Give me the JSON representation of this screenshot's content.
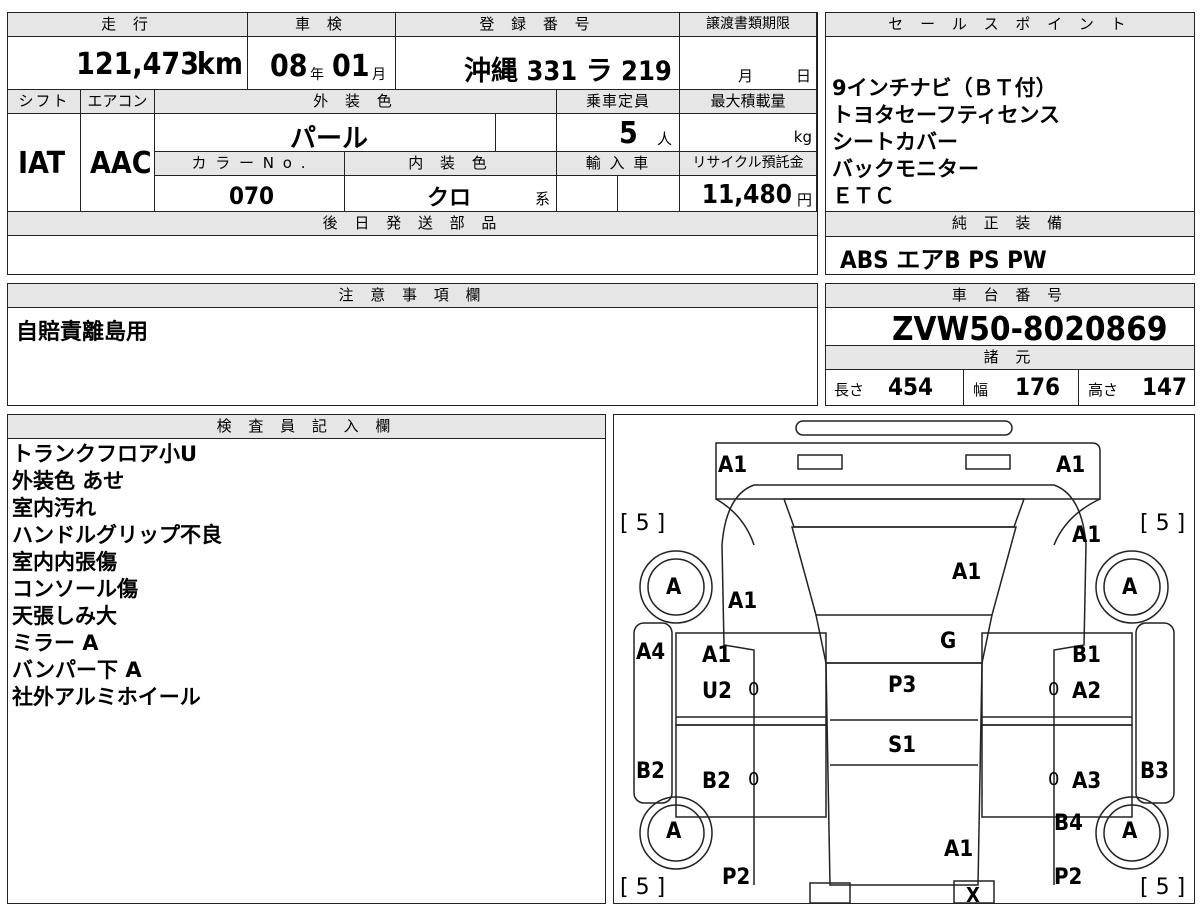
{
  "top": {
    "mileage_label": "走 行",
    "mileage_value": "121,473",
    "mileage_unit": "km",
    "shaken_label": "車 検",
    "shaken_year": "08",
    "shaken_year_unit": "年",
    "shaken_month": "01",
    "shaken_month_unit": "月",
    "reg_label": "登 録 番 号",
    "reg_value": "沖縄 331 ラ 219",
    "deadline_label": "譲渡書類期限",
    "deadline_month": "月",
    "deadline_day": "日",
    "shift_label": "シフト",
    "shift_value": "IAT",
    "ac_label": "エアコン",
    "ac_value": "AAC",
    "exterior_label": "外 装 色",
    "exterior_value": "パール",
    "seats_label": "乗車定員",
    "seats_value": "5",
    "seats_unit": "人",
    "load_label": "最大積載量",
    "load_unit": "kg",
    "color_no_label": "カ ラ ー N o .",
    "color_no_value": "070",
    "interior_label": "内 装 色",
    "interior_value": "クロ",
    "interior_unit": "系",
    "import_label": "輸 入 車",
    "recycle_label": "リサイクル預託金",
    "recycle_value": "11,480",
    "recycle_unit": "円",
    "later_label": "後 日 発 送 部 品"
  },
  "sales": {
    "label": "セ ー ル ス ポ イ ン ト",
    "items": [
      "9インチナビ（ＢＴ付）",
      "トヨタセーフティセンス",
      "シートカバー",
      "バックモニター",
      "ＥＴＣ"
    ]
  },
  "equipment": {
    "label": "純 正 装 備",
    "value": "ABS エアB PS PW"
  },
  "notes": {
    "label": "注 意 事 項 欄",
    "value": "自賠責離島用"
  },
  "chassis": {
    "label": "車 台 番 号",
    "value": "ZVW50-8020869",
    "dims_label": "諸 元",
    "length_label": "長さ",
    "length_value": "454",
    "width_label": "幅",
    "width_value": "176",
    "height_label": "高さ",
    "height_value": "147"
  },
  "inspector": {
    "label": "検 査 員 記 入 欄",
    "items": [
      "トランクフロア小U",
      "外装色 あせ",
      "室内汚れ",
      "ハンドルグリップ不良",
      "室内内張傷",
      "コンソール傷",
      "天張しみ大",
      "ミラー A",
      "バンパー下 A",
      "社外アルミホイール"
    ]
  },
  "diagram": {
    "rear_left": "A1",
    "rear_right": "A1",
    "tire_tl": "[ 5 ]",
    "tire_tr": "[ 5 ]",
    "tire_bl": "[ 5 ]",
    "tire_br": "[ 5 ]",
    "q_a": "A",
    "pillar_l": "A1",
    "pillar_r": "A1",
    "trunk_lid": "A1",
    "rear_glass": "G",
    "left_rear": "A4",
    "right_rear_top": "B1",
    "left_rear_door": "A1",
    "left_rear_door2": "U2",
    "right_rear_door": "A2",
    "roof": "P3",
    "roof2": "S1",
    "left_rocker": "B2",
    "left_front_door": "B2",
    "right_rocker": "B3",
    "right_front_door": "A3",
    "right_front": "B4",
    "hood": "A1",
    "left_front_fender": "P2",
    "right_front_fender": "P2",
    "front_mark": "X",
    "zero": "0"
  }
}
